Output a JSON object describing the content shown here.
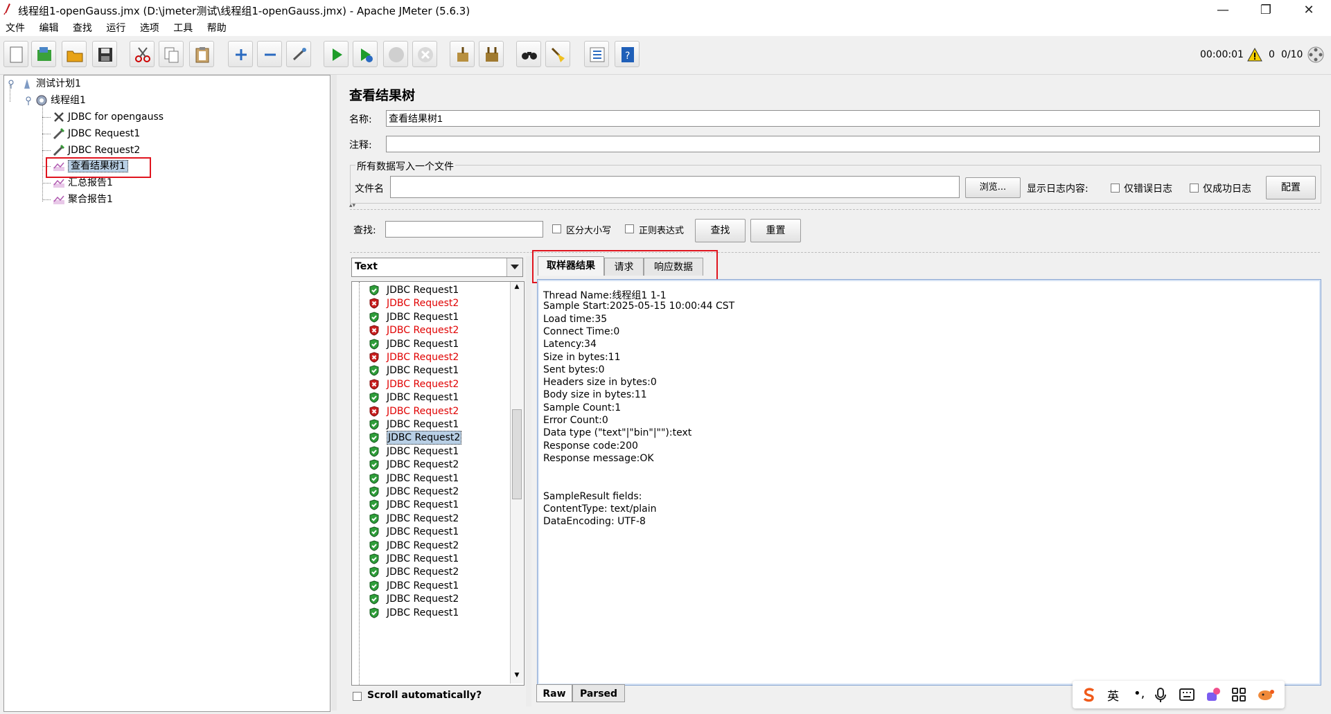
{
  "window": {
    "title": "线程组1-openGauss.jmx (D:\\jmeter测试\\线程组1-openGauss.jmx) - Apache JMeter (5.6.3)",
    "minimize": "—",
    "restore": "❐",
    "close": "✕"
  },
  "menu": [
    "文件",
    "编辑",
    "查找",
    "运行",
    "选项",
    "工具",
    "帮助"
  ],
  "toolbar_status": {
    "elapsed": "00:00:01",
    "warnings": "0",
    "threads": "0/10"
  },
  "tree": {
    "plan": "测试计划1",
    "thread_group": "线程组1",
    "children": [
      "JDBC for opengauss",
      "JDBC Request1",
      "JDBC Request2",
      "查看结果树1",
      "汇总报告1",
      "聚合报告1"
    ],
    "selected_index": 3
  },
  "panel": {
    "title": "查看结果树",
    "name_label": "名称:",
    "name_value": "查看结果树1",
    "comment_label": "注释:",
    "comment_value": "",
    "file_group_label": "所有数据写入一个文件",
    "file_label": "文件名",
    "file_value": "",
    "browse_button": "浏览...",
    "log_label": "显示日志内容:",
    "errors_only": "仅错误日志",
    "success_only": "仅成功日志",
    "config_button": "配置",
    "search_label": "查找:",
    "search_value": "",
    "case_sensitive": "区分大小写",
    "regex": "正则表达式",
    "find_button": "查找",
    "reset_button": "重置"
  },
  "renderer": {
    "selected": "Text"
  },
  "samples": [
    {
      "label": "JDBC Request1",
      "status": "ok"
    },
    {
      "label": "JDBC Request2",
      "status": "error"
    },
    {
      "label": "JDBC Request1",
      "status": "ok"
    },
    {
      "label": "JDBC Request2",
      "status": "error"
    },
    {
      "label": "JDBC Request1",
      "status": "ok"
    },
    {
      "label": "JDBC Request2",
      "status": "error"
    },
    {
      "label": "JDBC Request1",
      "status": "ok"
    },
    {
      "label": "JDBC Request2",
      "status": "error"
    },
    {
      "label": "JDBC Request1",
      "status": "ok"
    },
    {
      "label": "JDBC Request2",
      "status": "error"
    },
    {
      "label": "JDBC Request1",
      "status": "ok"
    },
    {
      "label": "JDBC Request2",
      "status": "ok",
      "selected": true
    },
    {
      "label": "JDBC Request1",
      "status": "ok"
    },
    {
      "label": "JDBC Request2",
      "status": "ok"
    },
    {
      "label": "JDBC Request1",
      "status": "ok"
    },
    {
      "label": "JDBC Request2",
      "status": "ok"
    },
    {
      "label": "JDBC Request1",
      "status": "ok"
    },
    {
      "label": "JDBC Request2",
      "status": "ok"
    },
    {
      "label": "JDBC Request1",
      "status": "ok"
    },
    {
      "label": "JDBC Request2",
      "status": "ok"
    },
    {
      "label": "JDBC Request1",
      "status": "ok"
    },
    {
      "label": "JDBC Request2",
      "status": "ok"
    },
    {
      "label": "JDBC Request1",
      "status": "ok"
    },
    {
      "label": "JDBC Request2",
      "status": "ok"
    },
    {
      "label": "JDBC Request1",
      "status": "ok"
    }
  ],
  "scroll_automatically": "Scroll automatically?",
  "result_tabs": [
    "取样器结果",
    "请求",
    "响应数据"
  ],
  "result_lines": [
    "Thread Name:线程组1 1-1",
    "Sample Start:2025-05-15 10:00:44 CST",
    "Load time:35",
    "Connect Time:0",
    "Latency:34",
    "Size in bytes:11",
    "Sent bytes:0",
    "Headers size in bytes:0",
    "Body size in bytes:11",
    "Sample Count:1",
    "Error Count:0",
    "Data type (\"text\"|\"bin\"|\"\"):text",
    "Response code:200",
    "Response message:OK",
    "",
    "",
    "SampleResult fields:",
    "ContentType: text/plain",
    "DataEncoding: UTF-8"
  ],
  "bottom_tabs": [
    "Raw",
    "Parsed"
  ],
  "ime": {
    "lang": "英"
  },
  "colors": {
    "error_text": "#e00000",
    "highlight_box": "#e0141e",
    "selection": "#b8cfe5"
  }
}
